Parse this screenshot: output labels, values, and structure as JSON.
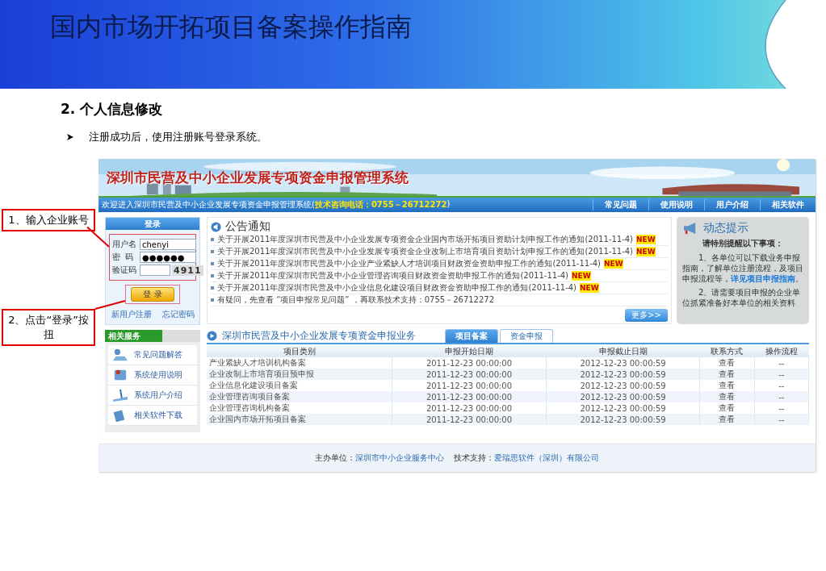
{
  "slide": {
    "title": "国内市场开拓项目备案操作指南",
    "section": "2.  个人信息修改",
    "bullet": "注册成功后，使用注册账号登录系统。"
  },
  "callouts": [
    {
      "text": "1、输入企业账号"
    },
    {
      "text": "2、点击“登录”按扭"
    }
  ],
  "site": {
    "title": "深圳市民营及中小企业发展专项资金申报管理系统",
    "welcome": "欢迎进入深圳市民营及中小企业发展专项资金申报管理系统(",
    "hotline": "技术咨询电话：0755－26712272",
    "welcome_end": ")",
    "nav": [
      "常见问题",
      "使用说明",
      "用户介绍",
      "相关软件"
    ],
    "login": {
      "title": "登录",
      "fields": [
        {
          "label": "用户名",
          "value": "chenyi"
        },
        {
          "label": "密  码",
          "value": "●●●●●●"
        },
        {
          "label": "验证码",
          "captcha": "4911"
        }
      ],
      "button": "登  录",
      "links": [
        "新用户注册",
        "忘记密码"
      ]
    },
    "notices": {
      "title": "公告通知",
      "items": [
        {
          "text": "关于开展2011年度深圳市民营及中小企业发展专项资金企业国内市场开拓项目资助计划申报工作的通知(2011-11-4)",
          "badge": "NEW"
        },
        {
          "text": "关于开展2011年度深圳市民营及中小企业发展专项资金企业改制上市培育项目资助计划申报工作的通知(2011-11-4)",
          "badge": "NEW"
        },
        {
          "text": "关于开展2011年度深圳市民营及中小企业产业紧缺人才培训项目财政资金资助申报工作的通知(2011-11-4)",
          "badge": "NEW"
        },
        {
          "text": "关于开展2011年度深圳市民营及中小企业管理咨询项目财政资金资助申报工作的通知(2011-11-4)",
          "badge": "NEW"
        },
        {
          "text": "关于开展2011年度深圳市民营及中小企业信息化建设项目财政资金资助申报工作的通知(2011-11-4)",
          "badge": "NEW"
        },
        {
          "text": "有疑问，先查看 “项目申报常见问题” ，再联系技术支持：0755－26712272"
        }
      ],
      "more": "更多>>"
    },
    "tips": {
      "title": "动态提示",
      "subtitle": "请特别提醒以下事项：",
      "para1": "1、各单位可以下载业务申报指南，了解单位注册流程，及项目申报流程等，",
      "para1_link": "详见项目申报指南",
      "para1_end": "。",
      "para2": "2、请需要项目申报的企业单位抓紧准备好本单位的相关资料"
    },
    "services": {
      "title": "相关服务",
      "items": [
        "常见问题解答",
        "系统使用说明",
        "系统用户介绍",
        "相关软件下载"
      ]
    },
    "business": {
      "title": "深圳市民营及中小企业发展专项资金申报业务",
      "tabs": [
        {
          "label": "项目备案",
          "selected": true
        },
        {
          "label": "资金申报",
          "selected": false
        }
      ],
      "columns": [
        "项目类别",
        "申报开始日期",
        "申报截止日期",
        "联系方式",
        "操作流程"
      ],
      "rows": [
        [
          "产业紧缺人才培训机构备案",
          "2011-12-23 00:00:00",
          "2012-12-23 00:00:59",
          "查看",
          "--"
        ],
        [
          "企业改制上市培育项目预申报",
          "2011-12-23 00:00:00",
          "2012-12-23 00:00:59",
          "查看",
          "--"
        ],
        [
          "企业信息化建设项目备案",
          "2011-12-23 00:00:00",
          "2012-12-23 00:00:59",
          "查看",
          "--"
        ],
        [
          "企业管理咨询项目备案",
          "2011-12-23 00:00:00",
          "2012-12-23 00:00:59",
          "查看",
          "--"
        ],
        [
          "企业管理咨询机构备案",
          "2011-12-23 00:00:00",
          "2012-12-23 00:00:59",
          "查看",
          "--"
        ],
        [
          "企业国内市场开拓项目备案",
          "2011-12-23 00:00:00",
          "2012-12-23 00:00:59",
          "查看",
          "--"
        ]
      ]
    },
    "footer": {
      "host_label": "主办单位：",
      "host": "深圳市中小企业服务中心",
      "support_label": "技术支持：",
      "support": "爱瑞思软件（深圳）有限公司"
    }
  }
}
